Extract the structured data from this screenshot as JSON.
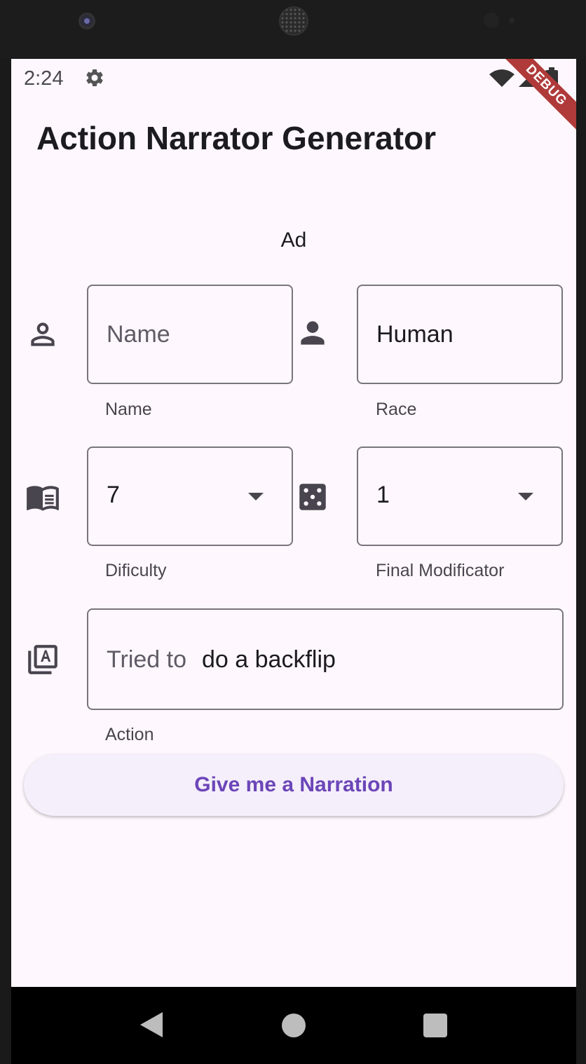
{
  "status_bar": {
    "time": "2:24",
    "debug_label": "DEBUG"
  },
  "app": {
    "title": "Action Narrator Generator",
    "ad_label": "Ad"
  },
  "form": {
    "name": {
      "placeholder": "Name",
      "value": "",
      "helper": "Name",
      "icon": "person-outline-icon"
    },
    "race": {
      "value": "Human",
      "helper": "Race",
      "icon": "person-filled-icon"
    },
    "difficulty": {
      "value": "7",
      "helper": "Dificulty",
      "icon": "book-icon"
    },
    "final_modifier": {
      "value": "1",
      "helper": "Final Modificator",
      "icon": "dice-icon"
    },
    "action": {
      "prefix": "Tried to",
      "value": "do a backflip",
      "helper": "Action",
      "icon": "text-library-icon"
    }
  },
  "button": {
    "label": "Give me a Narration"
  },
  "colors": {
    "background": "#fef7fd",
    "accent": "#6c45b8",
    "button_bg": "#f4effa",
    "debug_ribbon": "#b03a3a"
  }
}
